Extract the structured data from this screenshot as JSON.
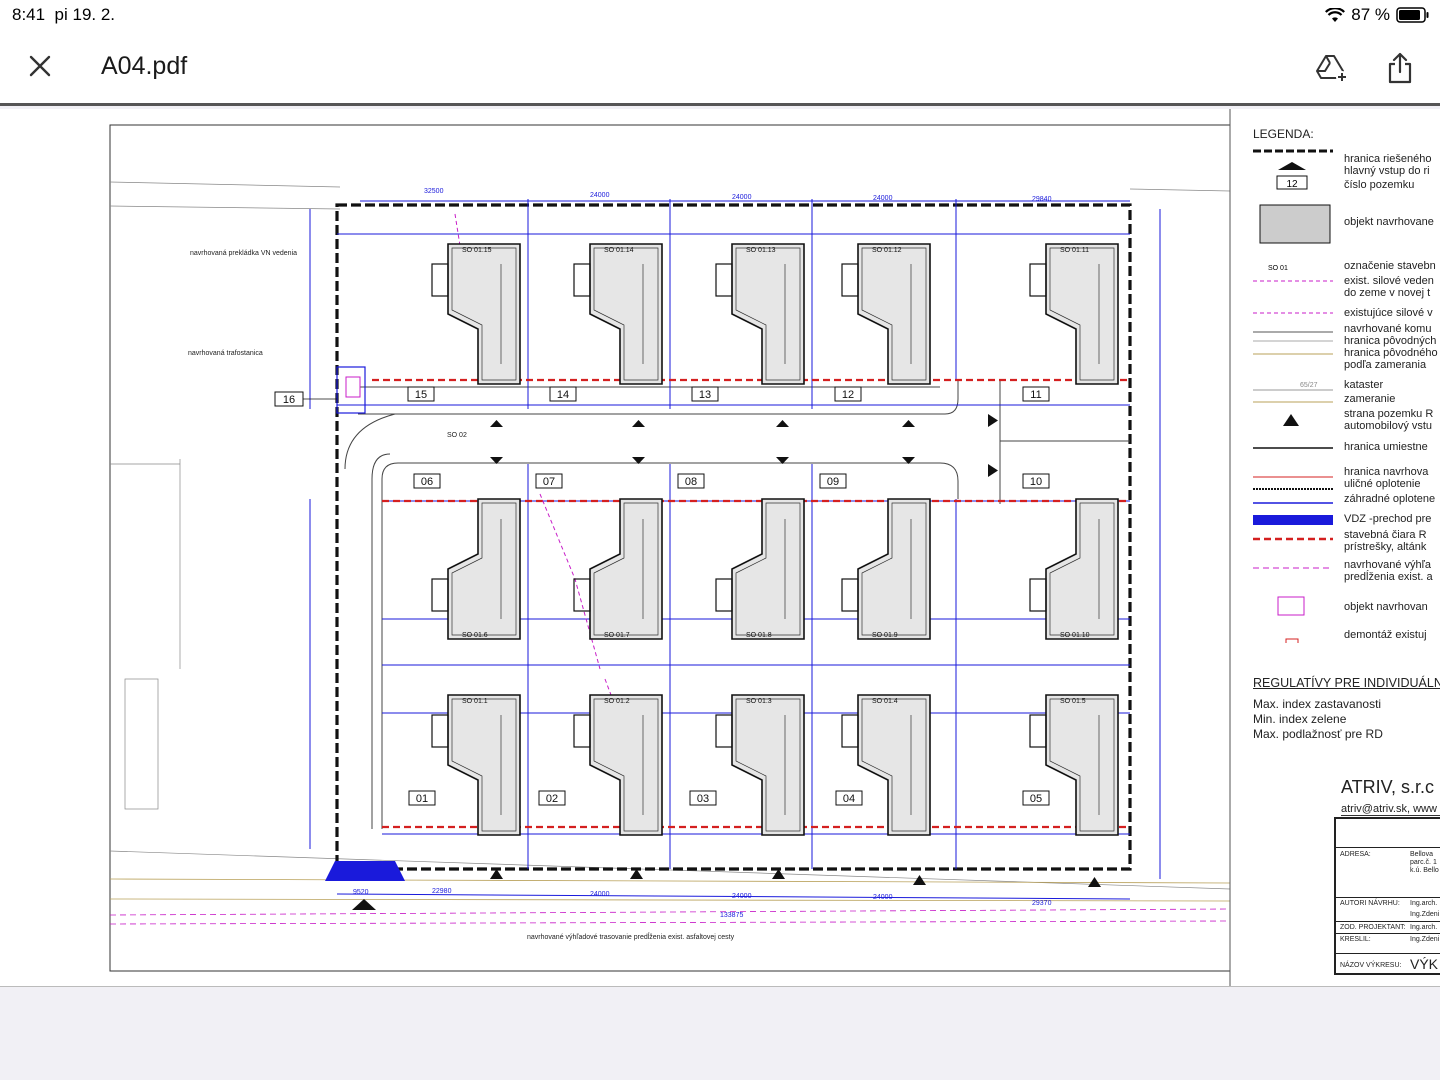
{
  "status": {
    "time": "8:41",
    "date": "pi 19. 2.",
    "battery": "87 %"
  },
  "toolbar": {
    "title": "A04.pdf"
  },
  "legend": {
    "title": "LEGENDA:",
    "items": [
      "hranica riešeného",
      "hlavný vstup do ri",
      "číslo pozemku",
      "objekt navrhovane",
      "označenie stavebn",
      "exist. silové veden",
      "do zeme v novej t",
      "existujúce silové v",
      "navrhované komu",
      "hranica pôvodných",
      "hranica pôvodného",
      "podľa zamerania",
      "kataster",
      "zameranie",
      "strana pozemku R",
      "automobilový vstu",
      "hranica umiestne",
      "hranica navrhova",
      "uličné oplotenie",
      "záhradné oplotene",
      "VDZ -prechod pre",
      "stavebná čiara R",
      "prístrešky, altánk",
      "navrhované výhľa",
      "predĺženia exist. a",
      "objekt navrhovan",
      "demontáž existuj"
    ],
    "plot_symbol": "12",
    "so_symbol": "SO 01",
    "kataster_symbol": "65/27"
  },
  "regulativy": {
    "title": "REGULATÍVY PRE INDIVIDUÁLN",
    "items": [
      "Max. index zastavanosti",
      "Min. index zelene",
      "Max. podlažnosť pre RD"
    ]
  },
  "company": {
    "name": "ATRIV, s.r.c",
    "email": "atriv@atriv.sk, www"
  },
  "titleblock": {
    "rows": [
      {
        "label": "ADRESA:",
        "value": "Bellova"
      },
      {
        "label": "",
        "value": "parc.č. 1"
      },
      {
        "label": "",
        "value": "k.ú. Bello"
      },
      {
        "label": "AUTORI NÁVRHU:",
        "value": "Ing.arch."
      },
      {
        "label": "",
        "value": "Ing.Zdeni"
      },
      {
        "label": "ZOD. PROJEKTANT:",
        "value": "Ing.arch."
      },
      {
        "label": "KRESLIL:",
        "value": "Ing.Zdeni"
      },
      {
        "label": "NÁZOV VÝKRESU:",
        "value": "VÝK"
      }
    ]
  },
  "plan": {
    "annotations": {
      "vn": "navrhovaná prekládka VN vedenia",
      "trafo": "navrhovaná trafostanica",
      "road": "navrhované výhľadové trasovanie predĺženia exist. asfaltovej cesty",
      "so02": "SO 02",
      "plot16": "16"
    },
    "top_row": [
      {
        "so": "SO 01.15",
        "plot": "15"
      },
      {
        "so": "SO 01.14",
        "plot": "14"
      },
      {
        "so": "SO 01.13",
        "plot": "13"
      },
      {
        "so": "SO 01.12",
        "plot": "12"
      },
      {
        "so": "SO 01.11",
        "plot": "11"
      }
    ],
    "mid_row": [
      {
        "so": "SO 01.6",
        "plot": "06"
      },
      {
        "so": "SO 01.7",
        "plot": "07"
      },
      {
        "so": "SO 01.8",
        "plot": "08"
      },
      {
        "so": "SO 01.9",
        "plot": "09"
      },
      {
        "so": "SO 01.10",
        "plot": "10"
      }
    ],
    "bottom_row": [
      {
        "so": "SO 01.1",
        "plot": "01"
      },
      {
        "so": "SO 01.2",
        "plot": "02"
      },
      {
        "so": "SO 01.3",
        "plot": "03"
      },
      {
        "so": "SO 01.4",
        "plot": "04"
      },
      {
        "so": "SO 01.5",
        "plot": "05"
      }
    ],
    "dims": {
      "d24000": "24000",
      "d11050": "11050",
      "d23020": "23020",
      "d133875": "133875",
      "d32500": "32500",
      "d29840": "29840",
      "d9520": "9520",
      "d22980": "22980",
      "d29370": "29370"
    }
  },
  "colors": {
    "blue": "#1a1adb",
    "red": "#d42020",
    "magenta": "#c81ec8",
    "black": "#111111"
  }
}
